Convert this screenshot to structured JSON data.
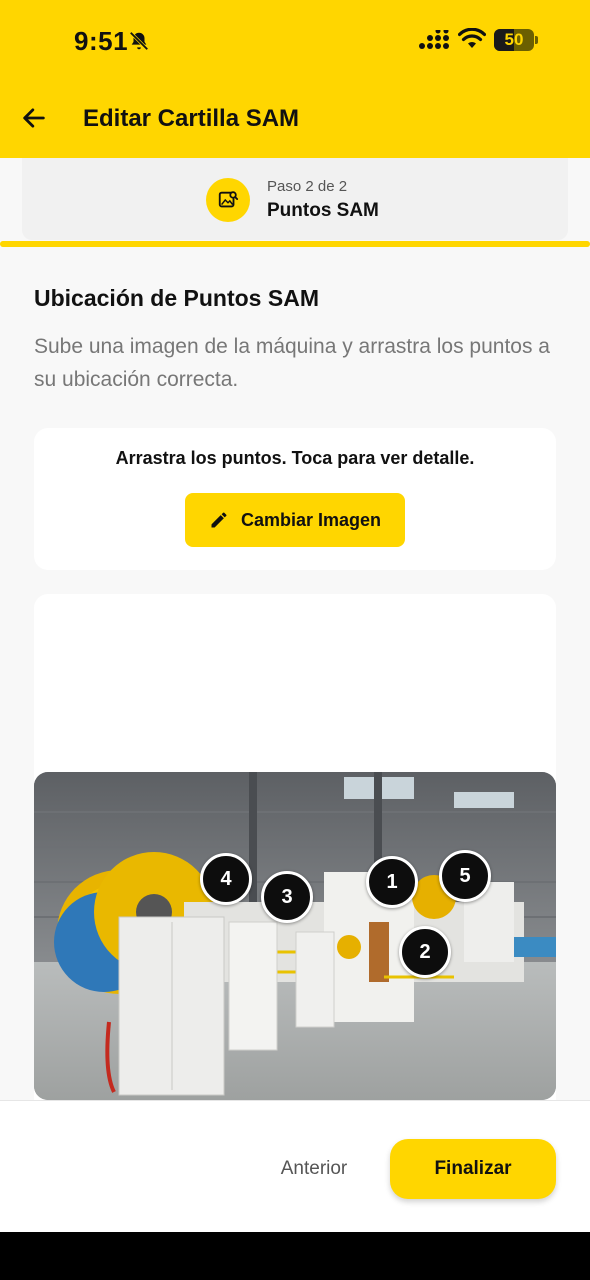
{
  "status_bar": {
    "time": "9:51",
    "battery": "50",
    "battery_level": 0.5,
    "icons": [
      "bell-off-icon",
      "signal-icon",
      "wifi-icon",
      "battery-icon"
    ]
  },
  "header": {
    "title": "Editar Cartilla SAM",
    "back_icon": "arrow-left-icon",
    "color": "#FFD600"
  },
  "step": {
    "sub": "Paso 2 de 2",
    "label": "Puntos SAM",
    "icon": "image-search-icon",
    "progress": 1.0
  },
  "section": {
    "title": "Ubicación de Puntos SAM",
    "description": "Sube una imagen de la máquina y arrastra los puntos a su ubicación correcta."
  },
  "instructions": {
    "text": "Arrastra los puntos. Toca para ver detalle.",
    "change_image_label": "Cambiar Imagen",
    "change_image_icon": "pencil-icon"
  },
  "points": [
    {
      "label": "4"
    },
    {
      "label": "3"
    },
    {
      "label": "1"
    },
    {
      "label": "5"
    },
    {
      "label": "2"
    }
  ],
  "footer": {
    "prev_label": "Anterior",
    "finish_label": "Finalizar"
  },
  "colors": {
    "accent": "#FFD600",
    "text": "#111111",
    "muted": "#777777"
  }
}
